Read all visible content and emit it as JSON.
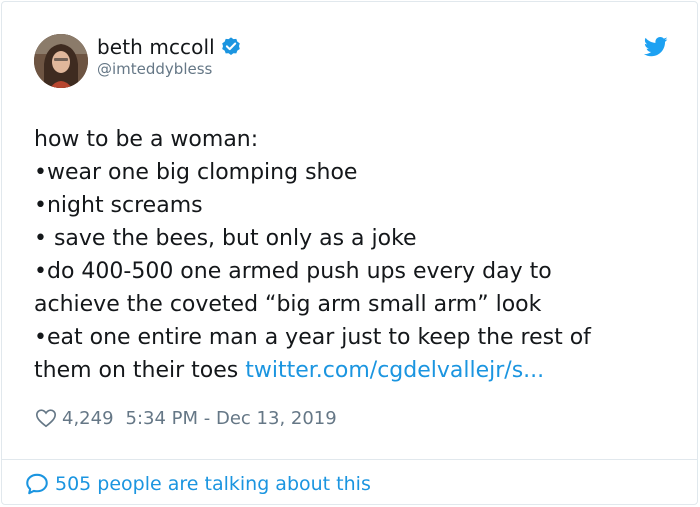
{
  "tweet": {
    "display_name": "beth mccoll",
    "handle": "@imteddybless",
    "lines": [
      "how to be a woman:",
      "•wear one big clomping shoe",
      "•night screams",
      "• save the bees, but only as a joke",
      "•do 400-500 one armed push ups every day to",
      "achieve the coveted “big arm small arm” look",
      "•eat one entire man a year just to keep the rest of",
      "them on their toes "
    ],
    "link_text": "twitter.com/cgdelvallejr/s...",
    "likes": "4,249",
    "timestamp": "5:34 PM - Dec 13, 2019",
    "talking": "505 people are talking about this"
  },
  "icons": {
    "verified": "verified-badge-icon",
    "bird": "twitter-bird-icon",
    "heart": "heart-icon",
    "bubble": "speech-bubble-icon"
  },
  "colors": {
    "accent": "#1b95e0",
    "text": "#14171a",
    "muted": "#657786",
    "border": "#e1e8ed"
  }
}
